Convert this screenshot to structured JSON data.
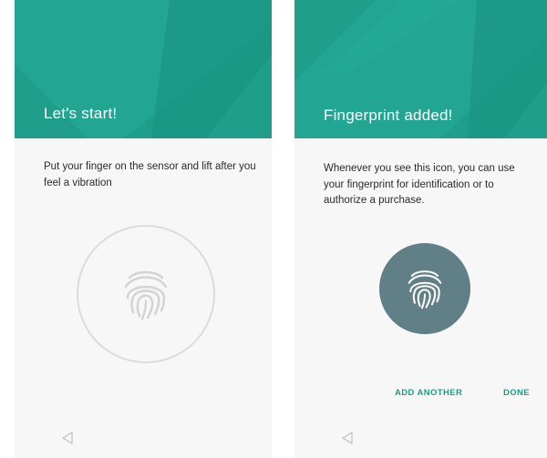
{
  "colors": {
    "accent": "#1f9e8c",
    "fingerprint_badge": "#607f86"
  },
  "screens": [
    {
      "title": "Let's start!",
      "instruction": "Put your finger on the sensor and lift after you feel a vibration",
      "icons": [
        "fingerprint-icon",
        "back-nav-icon"
      ]
    },
    {
      "title": "Fingerprint added!",
      "message": "Whenever you see this icon, you can use your fingerprint for identification or to authorize a purchase.",
      "buttons": {
        "add_another": "ADD ANOTHER",
        "done": "DONE"
      },
      "icons": [
        "fingerprint-icon",
        "back-nav-icon"
      ]
    }
  ]
}
